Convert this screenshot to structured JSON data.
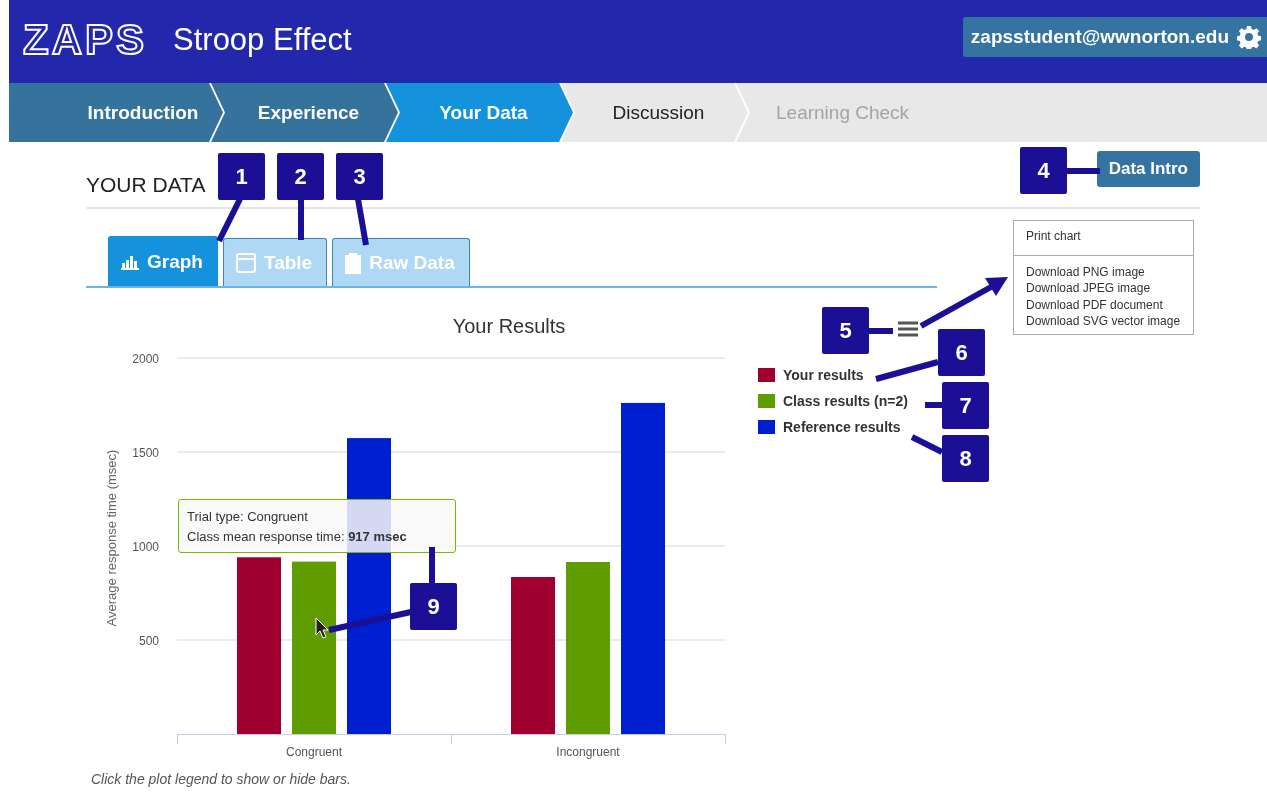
{
  "header": {
    "logo": "ZAPS",
    "title": "Stroop Effect",
    "user": "zapsstudent@wwnorton.edu"
  },
  "steps": [
    {
      "label": "Introduction",
      "completed": true,
      "selected": false,
      "disabled": false
    },
    {
      "label": "Experience",
      "completed": true,
      "selected": false,
      "disabled": false
    },
    {
      "label": "Your Data",
      "completed": false,
      "selected": true,
      "disabled": false
    },
    {
      "label": "Discussion",
      "completed": false,
      "selected": false,
      "disabled": false
    },
    {
      "label": "Learning Check",
      "completed": false,
      "selected": false,
      "disabled": true
    }
  ],
  "section": {
    "heading": "YOUR DATA",
    "button": "Data Intro"
  },
  "tabs": [
    {
      "label": "Graph",
      "selected": true
    },
    {
      "label": "Table",
      "selected": false
    },
    {
      "label": "Raw Data",
      "selected": false
    }
  ],
  "chart": {
    "chart_data": {
      "type": "bar",
      "title": "Your Results",
      "ylabel": "Average response time (msec)",
      "categories": [
        "Congruent",
        "Incongruent"
      ],
      "ylim": [
        0,
        2000
      ],
      "grid": true,
      "yticks": [
        500,
        1000,
        1500,
        2000
      ],
      "series": [
        {
          "name": "Your results",
          "color": "#a0002f",
          "values": [
            940,
            835
          ]
        },
        {
          "name": "Class results (n=2)",
          "color": "#5e9c00",
          "values": [
            917,
            915
          ]
        },
        {
          "name": "Reference results",
          "color": "#001fd1",
          "values": [
            1574,
            1761
          ]
        }
      ]
    },
    "tooltip": {
      "lines": [
        "Trial type: Congruent",
        "Class mean response time: **917 msec**"
      ]
    }
  },
  "export_menu": {
    "groups": [
      [
        "Print chart"
      ],
      [
        "Download PNG image",
        "Download JPEG image",
        "Download PDF document",
        "Download SVG vector image"
      ]
    ]
  },
  "note": "Click the plot legend to show or hide bars.",
  "callouts": [
    {
      "label": "1"
    },
    {
      "label": "2"
    },
    {
      "label": "3"
    },
    {
      "label": "4"
    },
    {
      "label": "5"
    },
    {
      "label": "6"
    },
    {
      "label": "7"
    },
    {
      "label": "8"
    },
    {
      "label": "9"
    }
  ]
}
